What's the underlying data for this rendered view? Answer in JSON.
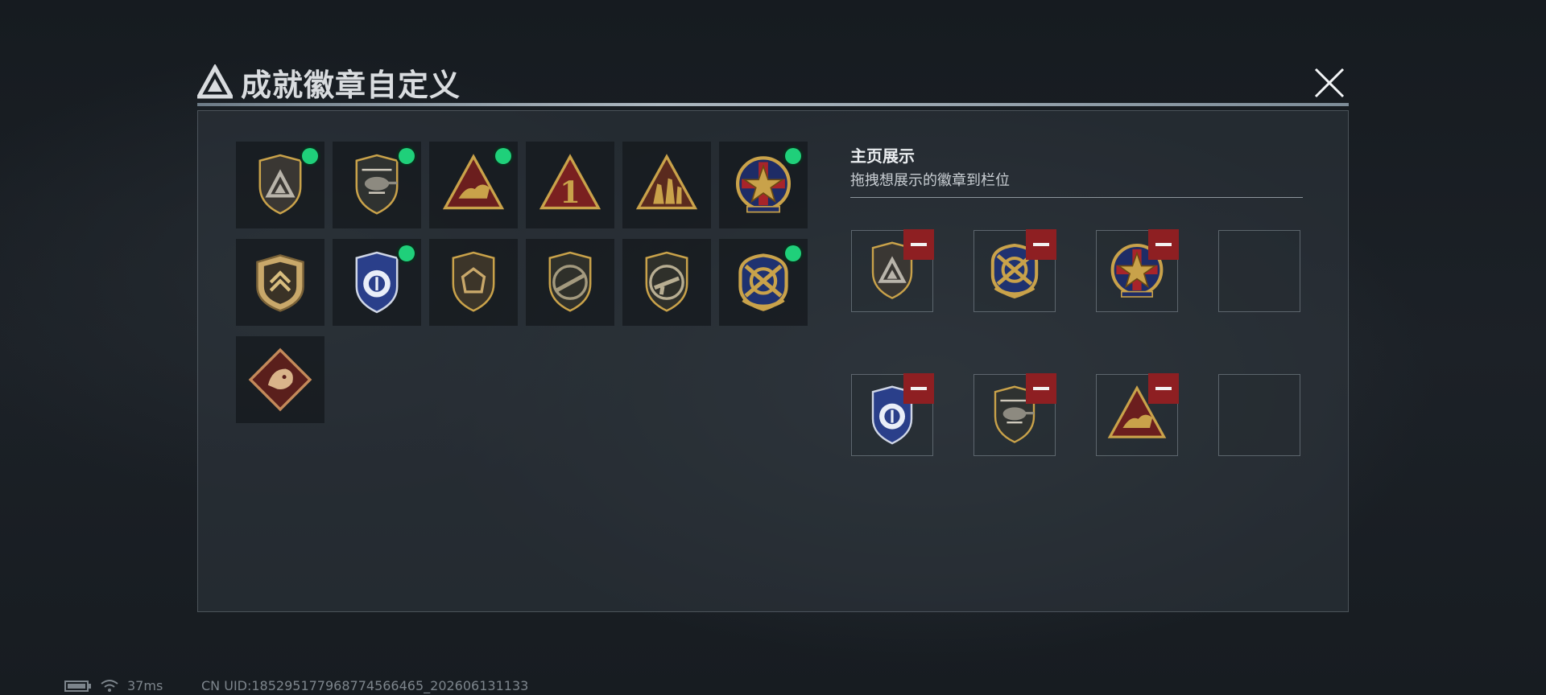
{
  "header": {
    "title": "成就徽章自定义",
    "close_icon": "close-icon"
  },
  "badges": [
    {
      "icon": "shield-triangle-badge-icon",
      "new": true
    },
    {
      "icon": "helicopter-badge-icon",
      "new": true
    },
    {
      "icon": "hand-triangle-badge-icon",
      "new": true
    },
    {
      "icon": "number-one-triangle-badge-icon",
      "new": false
    },
    {
      "icon": "soldiers-triangle-badge-icon",
      "new": false
    },
    {
      "icon": "star-medal-badge-icon",
      "new": true
    },
    {
      "icon": "chevron-shield-badge-icon",
      "new": false
    },
    {
      "icon": "police-shield-badge-icon",
      "new": true
    },
    {
      "icon": "polygon-shield-badge-icon",
      "new": false
    },
    {
      "icon": "rifle-shield-badge-icon",
      "new": false
    },
    {
      "icon": "smg-shield-badge-icon",
      "new": false
    },
    {
      "icon": "crossed-guns-medal-badge-icon",
      "new": true
    },
    {
      "icon": "dragon-diamond-badge-icon",
      "new": false
    }
  ],
  "home_display": {
    "title": "主页展示",
    "subtitle": "拖拽想展示的徽章到栏位",
    "slots": [
      {
        "icon": "shield-triangle-badge-icon",
        "filled": true
      },
      {
        "icon": "crossed-guns-medal-badge-icon",
        "filled": true
      },
      {
        "icon": "star-medal-badge-icon",
        "filled": true
      },
      {
        "icon": "",
        "filled": false
      },
      {
        "icon": "police-shield-badge-icon",
        "filled": true
      },
      {
        "icon": "helicopter-badge-icon",
        "filled": true
      },
      {
        "icon": "hand-triangle-badge-icon",
        "filled": true
      },
      {
        "icon": "",
        "filled": false
      }
    ]
  },
  "status_bar": {
    "ping": "37ms",
    "uid": "CN UID:185295177968774566465_202606131133"
  },
  "colors": {
    "new_dot": "#1fd07a",
    "remove_button": "#8e1f22",
    "gold": "#c9a24a"
  }
}
